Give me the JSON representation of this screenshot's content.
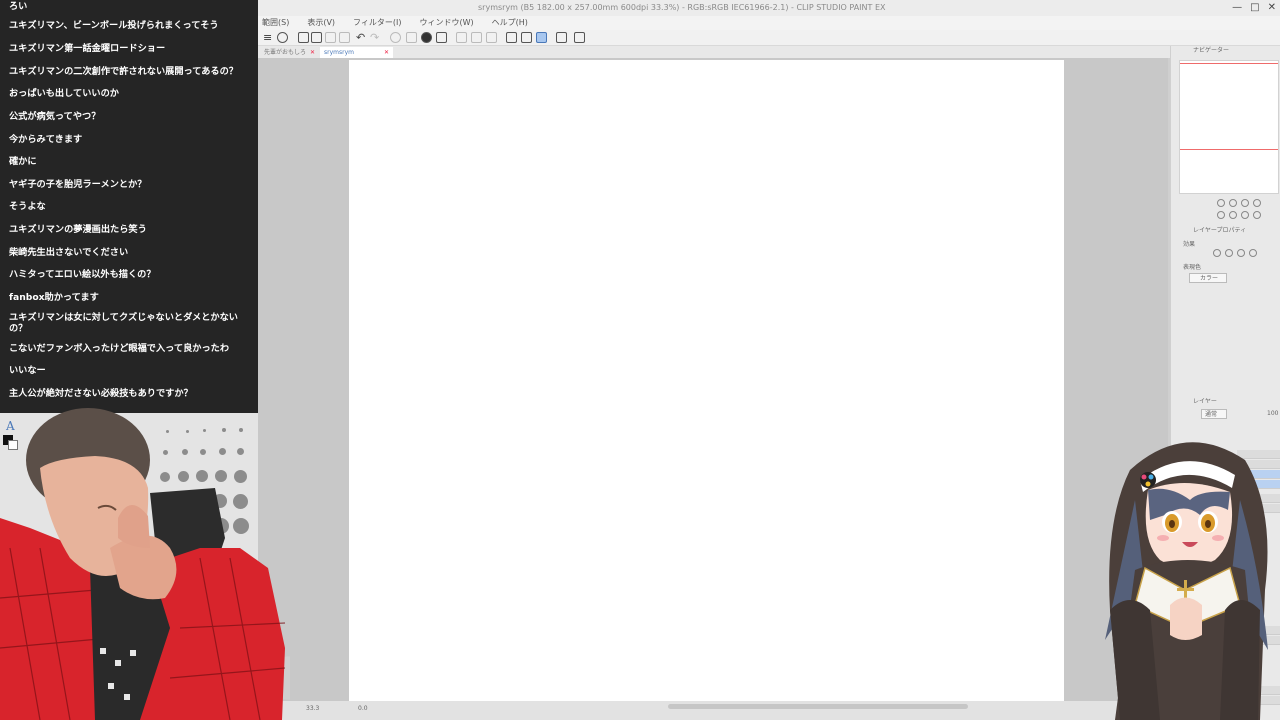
{
  "window": {
    "title": "srymsrym (B5 182.00 x 257.00mm 600dpi 33.3%) - RGB:sRGB IEC61966-2.1) - CLIP STUDIO PAINT EX",
    "controls": [
      "—",
      "□",
      "✕"
    ]
  },
  "menu": {
    "items": [
      "範囲(S)",
      "表示(V)",
      "フィルター(I)",
      "ウィンドウ(W)",
      "ヘルプ(H)"
    ]
  },
  "tabs": [
    {
      "label": "先輩がおもしろ",
      "active": false
    },
    {
      "label": "srymsrym",
      "active": true
    }
  ],
  "status": {
    "zoom": "33.3",
    "angle": "0.0"
  },
  "panels": {
    "navigator_title": "ナビゲーター",
    "layer_property_title": "レイヤープロパティ",
    "effect_label": "効果",
    "expression_color_label": "表現色",
    "expression_color_value": "カラー",
    "layer_title": "レイヤー",
    "blend_mode": "通常",
    "opacity": "100"
  },
  "comments": [
    "ろい",
    "ユキズリマン、ビーンボール投げられまくってそう",
    "ユキズリマン第一話金曜ロードショー",
    "ユキズリマンの二次創作で許されない展開ってあるの？",
    "おっぱいも出していいのか",
    "公式が病気ってやつ？",
    "今からみてきます",
    "確かに",
    "ヤギ子の子を胎児ラーメンとか？",
    "そうよな",
    "ユキズリマンの夢漫画出たら笑う",
    "柴崎先生出さないでください",
    "ハミタってエロい絵以外も描くの？",
    "fanbox助かってます",
    "ユキズリマンは女に対してクズじゃないとダメとかないの？",
    "こないだファンボ入ったけど眼福で入って良かったわ",
    "いいなー",
    "主人公が絶対ださない必殺技もありですか？"
  ],
  "colors": {
    "comment_bg": "#161616",
    "canvas": "#ffffff",
    "workspace": "#c8c8c8",
    "accent": "#4a78b8",
    "jacket": "#d8242c"
  }
}
